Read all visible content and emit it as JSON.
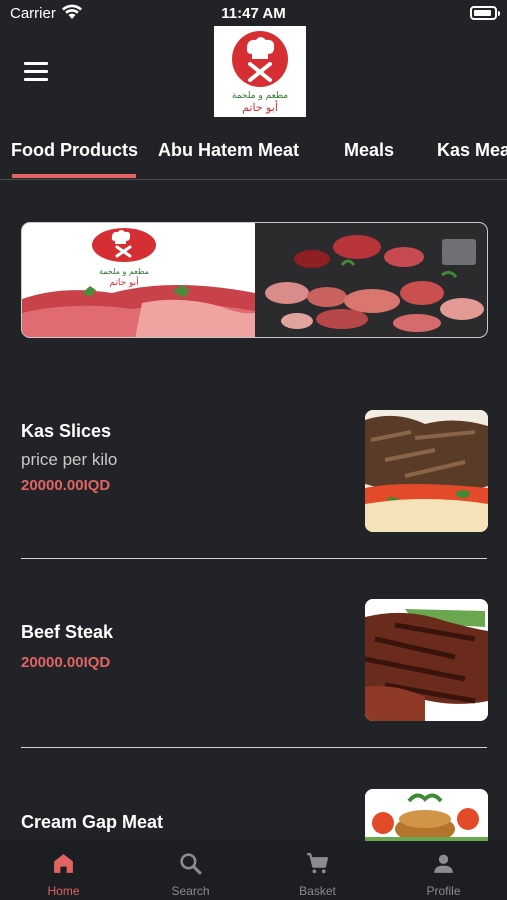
{
  "status_bar": {
    "carrier": "Carrier",
    "time": "11:47 AM"
  },
  "header": {
    "logo_text_ar_top": "مطعم و ملحمة",
    "logo_text_ar_bottom": "أبو حاتم"
  },
  "tabs": [
    {
      "label": "Food Products",
      "active": true
    },
    {
      "label": "Abu Hatem Meat",
      "active": false
    },
    {
      "label": "Meals",
      "active": false
    },
    {
      "label": "Kas Meat",
      "active": false
    }
  ],
  "banner": {
    "logo_text_ar_top": "مطعم و ملحمة",
    "logo_text_ar_bottom": "أبو حاتم"
  },
  "products": [
    {
      "name": "Kas Slices",
      "description": "price per kilo",
      "price": "20000.00IQD",
      "image": "kas-slices"
    },
    {
      "name": "Beef Steak",
      "description": "",
      "price": "20000.00IQD",
      "image": "beef-steak"
    },
    {
      "name": "Cream Gap Meat",
      "description": "",
      "price": "",
      "image": "cream-gap-meat"
    }
  ],
  "bottom_nav": [
    {
      "label": "Home",
      "icon": "home-icon",
      "active": true
    },
    {
      "label": "Search",
      "icon": "search-icon",
      "active": false
    },
    {
      "label": "Basket",
      "icon": "cart-icon",
      "active": false
    },
    {
      "label": "Profile",
      "icon": "person-icon",
      "active": false
    }
  ],
  "colors": {
    "accent": "#e06464",
    "background": "#222326",
    "nav_inactive": "#8b8c90"
  }
}
